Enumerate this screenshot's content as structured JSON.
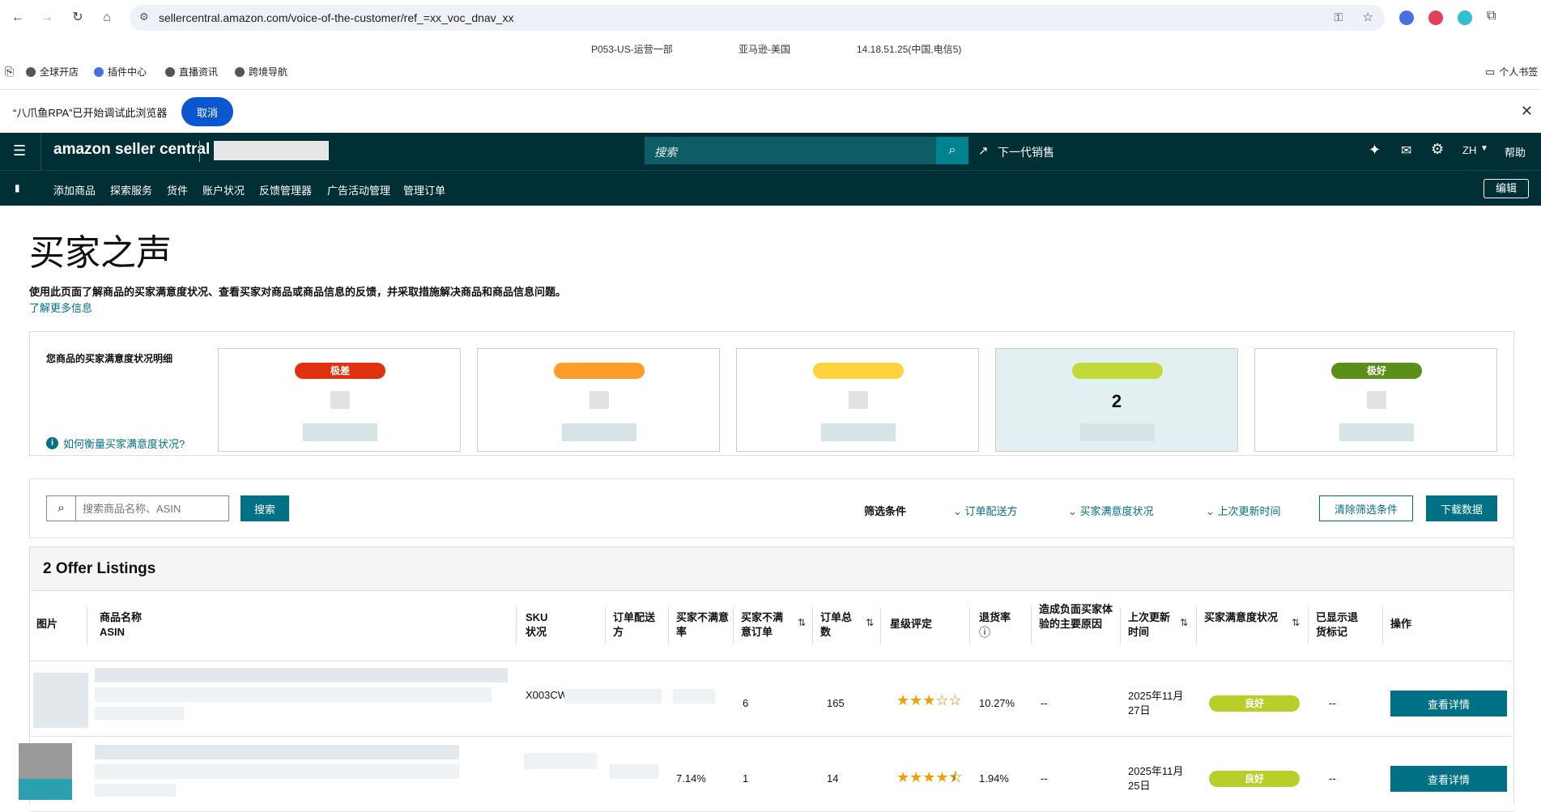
{
  "browser": {
    "url": "sellercentral.amazon.com/voice-of-the-customer/ref_=xx_voc_dnav_xx",
    "info": [
      "P053-US-运营一部",
      "亚马逊-美国",
      "14.18.51.25(中国,电信5)"
    ],
    "bookmarks": [
      "全球开店",
      "插件中心",
      "直播资讯",
      "跨境导航"
    ],
    "bookmarks_right": "个人书签",
    "debug_text": "“八爪鱼RPA”已开始调试此浏览器",
    "cancel": "取消"
  },
  "header": {
    "logo": "amazon seller central",
    "search_placeholder": "搜索",
    "next_gen": "下一代销售",
    "lang": "ZH",
    "help": "帮助",
    "nav": [
      "添加商品",
      "探索服务",
      "货件",
      "账户状况",
      "反馈管理器",
      "广告活动管理",
      "管理订单"
    ],
    "edit": "编辑"
  },
  "page": {
    "title": "买家之声",
    "description": "使用此页面了解商品的买家满意度状况、查看买家对商品或商品信息的反馈，并采取措施解决商品和商品信息问题。",
    "learn_more": "了解更多信息"
  },
  "summary": {
    "title": "您商品的买家满意度状况明细",
    "how_link": "如何衡量买家满意度状况?",
    "cards": [
      {
        "label": "极差",
        "color": "#e0320e",
        "value": ""
      },
      {
        "label": "",
        "color": "#ff9d2a",
        "value": ""
      },
      {
        "label": "",
        "color": "#ffd33d",
        "value": ""
      },
      {
        "label": "",
        "color": "#c3d93a",
        "value": "2"
      },
      {
        "label": "极好",
        "color": "#5b8e1b",
        "value": ""
      }
    ]
  },
  "filters": {
    "search_placeholder": "搜索商品名称、ASIN",
    "search_btn": "搜索",
    "label": "筛选条件",
    "fulfillment": "订单配送方",
    "satisfaction": "买家满意度状况",
    "last_updated": "上次更新时间",
    "clear": "清除筛选条件",
    "download": "下载数据"
  },
  "listings": {
    "title": "2 Offer Listings",
    "columns": {
      "image": "图片",
      "name": "商品名称",
      "asin": "ASIN",
      "sku": "SKU",
      "status": "状况",
      "fulfillment": "订单配送方",
      "unsat_rate": "买家不满意率",
      "unsat_orders": "买家不满意订单",
      "total_orders": "订单总数",
      "stars": "星级评定",
      "return_rate": "退货率",
      "neg_reason": "造成负面买家体验的主要原因",
      "last_updated": "上次更新时间",
      "satisfaction": "买家满意度状况",
      "return_badge": "已显示退货标记",
      "action": "操作"
    },
    "rows": [
      {
        "sku": "X003CW",
        "unsat_rate": "",
        "unsat_orders": "6",
        "total_orders": "165",
        "rating": 3,
        "return_rate": "10.27%",
        "neg_reason": "--",
        "updated": "2025年11月27日",
        "status": "良好",
        "badge": "--",
        "action": "查看详情"
      },
      {
        "sku": "",
        "unsat_rate": "7.14%",
        "unsat_orders": "1",
        "total_orders": "14",
        "rating": 4.5,
        "return_rate": "1.94%",
        "neg_reason": "--",
        "updated": "2025年11月25日",
        "status": "良好",
        "badge": "--",
        "action": "查看详情"
      }
    ]
  }
}
